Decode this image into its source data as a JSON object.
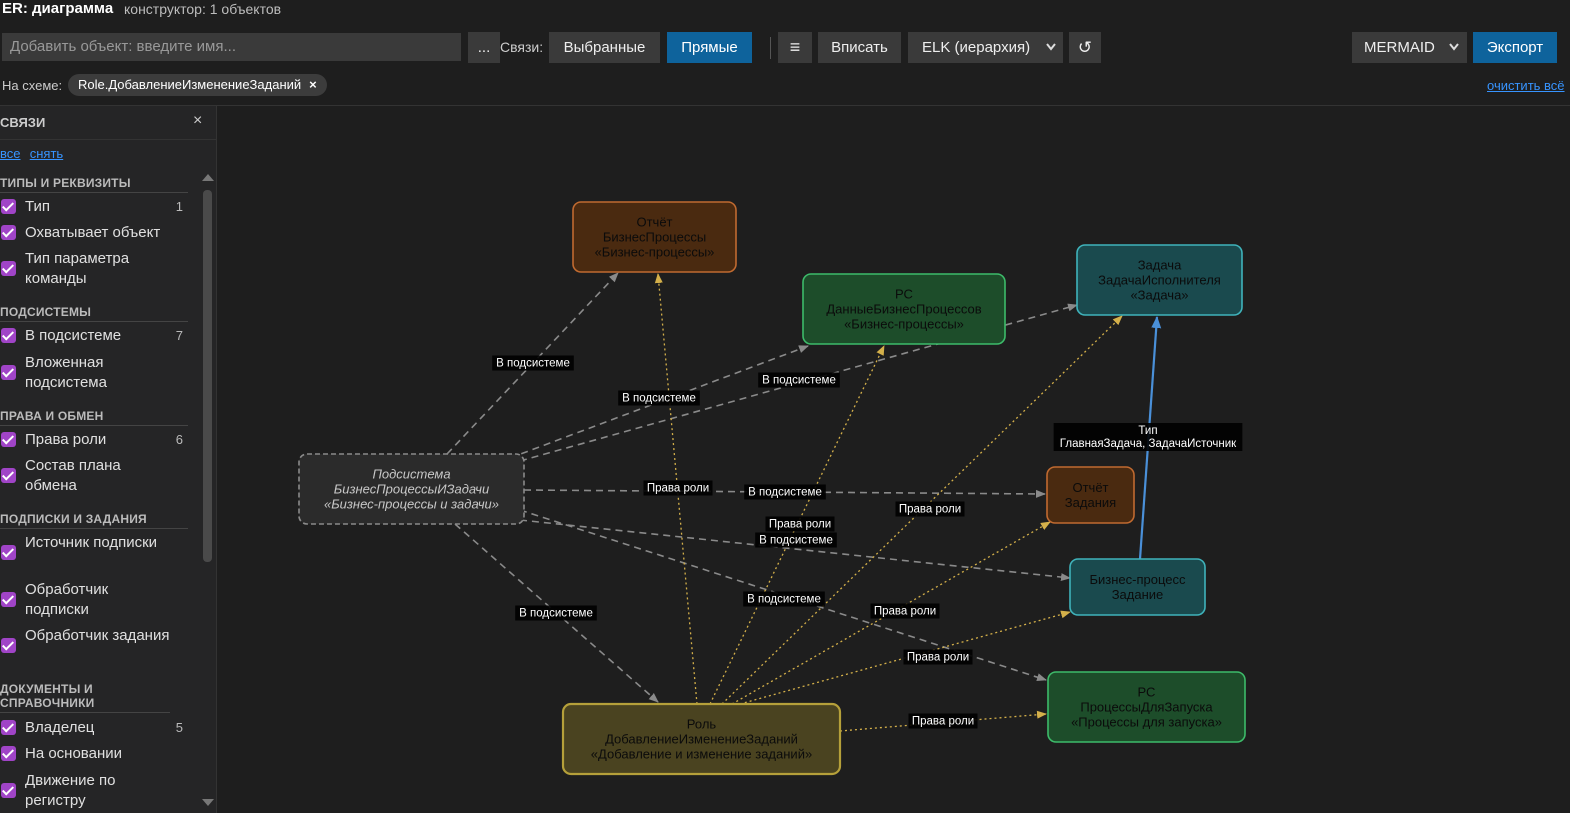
{
  "header": {
    "title": "ER: диаграмма",
    "subtitle": "конструктор: 1 объектов"
  },
  "toolbar": {
    "add_placeholder": "Добавить объект: введите имя...",
    "more_label": "...",
    "links_label": "Связи:",
    "selected_label": "Выбранные",
    "direct_label": "Прямые",
    "menu_icon": "≡",
    "fit_label": "Вписать",
    "layout_value": "ELK (иерархия)",
    "refresh_icon": "↺",
    "format_value": "MERMAID",
    "export_label": "Экспорт"
  },
  "schema": {
    "label": "На схеме:",
    "chip": "Role.ДобавлениеИзменениеЗаданий",
    "chip_close": "×",
    "clear_all": "очистить всё"
  },
  "sidebar": {
    "title": "СВЯЗИ",
    "close": "×",
    "all_link": "все",
    "none_link": "снять",
    "groups": [
      {
        "title": "ТИПЫ И РЕКВИЗИТЫ",
        "items": [
          {
            "label": "Тип",
            "count": "1",
            "checked": true
          },
          {
            "label": "Охватывает объект",
            "count": "",
            "checked": true
          },
          {
            "label": "Тип параметра команды",
            "count": "",
            "checked": true
          }
        ]
      },
      {
        "title": "ПОДСИСТЕМЫ",
        "items": [
          {
            "label": "В подсистеме",
            "count": "7",
            "checked": true
          },
          {
            "label": "Вложенная подсистема",
            "count": "",
            "checked": true
          }
        ]
      },
      {
        "title": "ПРАВА И ОБМЕН",
        "items": [
          {
            "label": "Права роли",
            "count": "6",
            "checked": true
          },
          {
            "label": "Состав плана обмена",
            "count": "",
            "checked": true
          }
        ]
      },
      {
        "title": "ПОДПИСКИ И ЗАДАНИЯ",
        "items": [
          {
            "label": "Источник подписки",
            "count": "",
            "checked": true
          },
          {
            "label": "Обработчик подписки",
            "count": "",
            "checked": true
          },
          {
            "label": "Обработчик задания",
            "count": "",
            "checked": true
          }
        ]
      },
      {
        "title": "ДОКУМЕНТЫ И СПРАВОЧНИКИ",
        "items": [
          {
            "label": "Владелец",
            "count": "5",
            "checked": true
          },
          {
            "label": "На основании",
            "count": "",
            "checked": true
          },
          {
            "label": "Движение по регистру",
            "count": "",
            "checked": true
          }
        ]
      }
    ]
  },
  "diagram": {
    "nodes": [
      {
        "id": "report_bp",
        "lines": [
          "Отчёт",
          "БизнесПроцессы",
          "«Бизнес-процессы»"
        ],
        "kind": "report",
        "italic": false
      },
      {
        "id": "rs_bp",
        "lines": [
          "РС",
          "ДанныеБизнесПроцессов",
          "«Бизнес-процессы»"
        ],
        "kind": "register",
        "italic": false
      },
      {
        "id": "task",
        "lines": [
          "Задача",
          "ЗадачаИсполнителя",
          "«Задача»"
        ],
        "kind": "process",
        "italic": false
      },
      {
        "id": "subsystem",
        "lines": [
          "Подсистема",
          "БизнесПроцессыИЗадачи",
          "«Бизнес-процессы и задачи»"
        ],
        "kind": "subsystem",
        "italic": true
      },
      {
        "id": "report_task",
        "lines": [
          "Отчёт",
          "Задания"
        ],
        "kind": "report",
        "italic": false
      },
      {
        "id": "bp_task",
        "lines": [
          "Бизнес-процесс",
          "Задание"
        ],
        "kind": "process",
        "italic": false
      },
      {
        "id": "rs_launch",
        "lines": [
          "РС",
          "ПроцессыДляЗапуска",
          "«Процессы для запуска»"
        ],
        "kind": "register",
        "italic": false
      },
      {
        "id": "role",
        "lines": [
          "Роль",
          "ДобавлениеИзменениеЗаданий",
          "«Добавление и изменение заданий»"
        ],
        "kind": "role",
        "italic": false
      }
    ],
    "edges": [
      {
        "label": "В подсистеме",
        "style": "sub"
      },
      {
        "label": "В подсистеме",
        "style": "sub"
      },
      {
        "label": "В подсистеме",
        "style": "sub"
      },
      {
        "label": "В подсистеме",
        "style": "sub"
      },
      {
        "label": "В подсистеме",
        "style": "sub"
      },
      {
        "label": "В подсистеме",
        "style": "sub"
      },
      {
        "label": "В подсистеме",
        "style": "sub"
      },
      {
        "label": "Права роли",
        "style": "rights"
      },
      {
        "label": "Права роли",
        "style": "rights"
      },
      {
        "label": "Права роли",
        "style": "rights"
      },
      {
        "label": "Права роли",
        "style": "rights"
      },
      {
        "label": "Права роли",
        "style": "rights"
      },
      {
        "label": "Права роли",
        "style": "rights"
      },
      {
        "label": "Тип\nГлавнаяЗадача, ЗадачаИсточник",
        "style": "type"
      }
    ],
    "colors": {
      "report_fill": "#4a2a10",
      "report_stroke": "#c06a30",
      "register_fill": "#1d4d2a",
      "register_stroke": "#3dbb6a",
      "process_fill": "#1a4a4e",
      "process_stroke": "#3fb3bb",
      "subsystem_fill": "#2b2b2b",
      "subsystem_stroke": "#8a8a8a",
      "role_fill": "#4a4320",
      "role_stroke": "#b5a03a",
      "sub_edge": "#8a8a8a",
      "rights_edge": "#d4b04a",
      "type_edge": "#4a90d9"
    }
  }
}
